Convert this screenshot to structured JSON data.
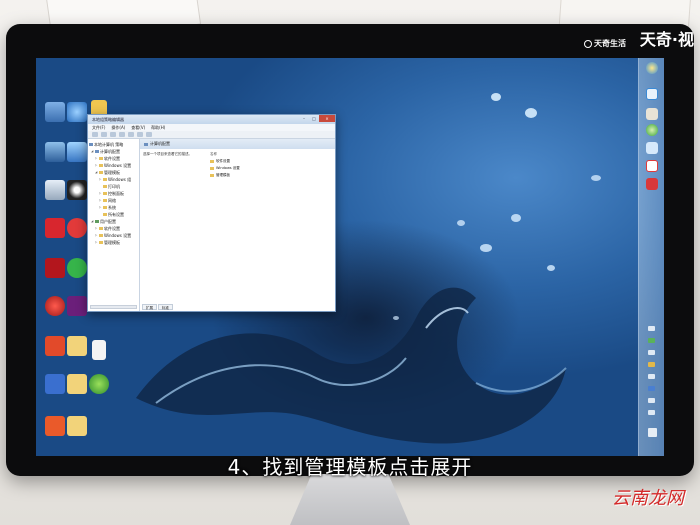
{
  "subtitle": "4、找到管理模板点击展开",
  "watermark_top": {
    "brand": "天奇·视",
    "sub": "天奇生活"
  },
  "watermark_bottom": "云南龙网",
  "window": {
    "title": "本地组策略编辑器",
    "menu": [
      "文件(F)",
      "操作(A)",
      "查看(V)",
      "帮助(H)"
    ],
    "tree": [
      {
        "label": "本地计算机 策略",
        "type": "pc"
      },
      {
        "label": "计算机配置",
        "type": "pc"
      },
      {
        "label": "软件设置",
        "type": "f"
      },
      {
        "label": "Windows 设置",
        "type": "f"
      },
      {
        "label": "管理模板",
        "type": "f"
      },
      {
        "label": "Windows 组",
        "type": "f"
      },
      {
        "label": "打印机",
        "type": "f"
      },
      {
        "label": "控制面板",
        "type": "f"
      },
      {
        "label": "网络",
        "type": "f"
      },
      {
        "label": "系统",
        "type": "f"
      },
      {
        "label": "所有设置",
        "type": "f"
      },
      {
        "label": "用户配置",
        "type": "u"
      },
      {
        "label": "软件设置",
        "type": "f"
      },
      {
        "label": "Windows 设置",
        "type": "f"
      },
      {
        "label": "管理模板",
        "type": "f"
      }
    ],
    "right_header": "计算机配置",
    "description": "选择一个项目来查看它的描述。",
    "list_header": "名称",
    "list": [
      "软件设置",
      "Windows 设置",
      "管理模板"
    ],
    "tabs": [
      "扩展",
      "标准"
    ]
  },
  "colors": {
    "subtitle": "#ffffff",
    "watermark_red": "#d42a2a",
    "window_border": "#7a9bc2"
  }
}
